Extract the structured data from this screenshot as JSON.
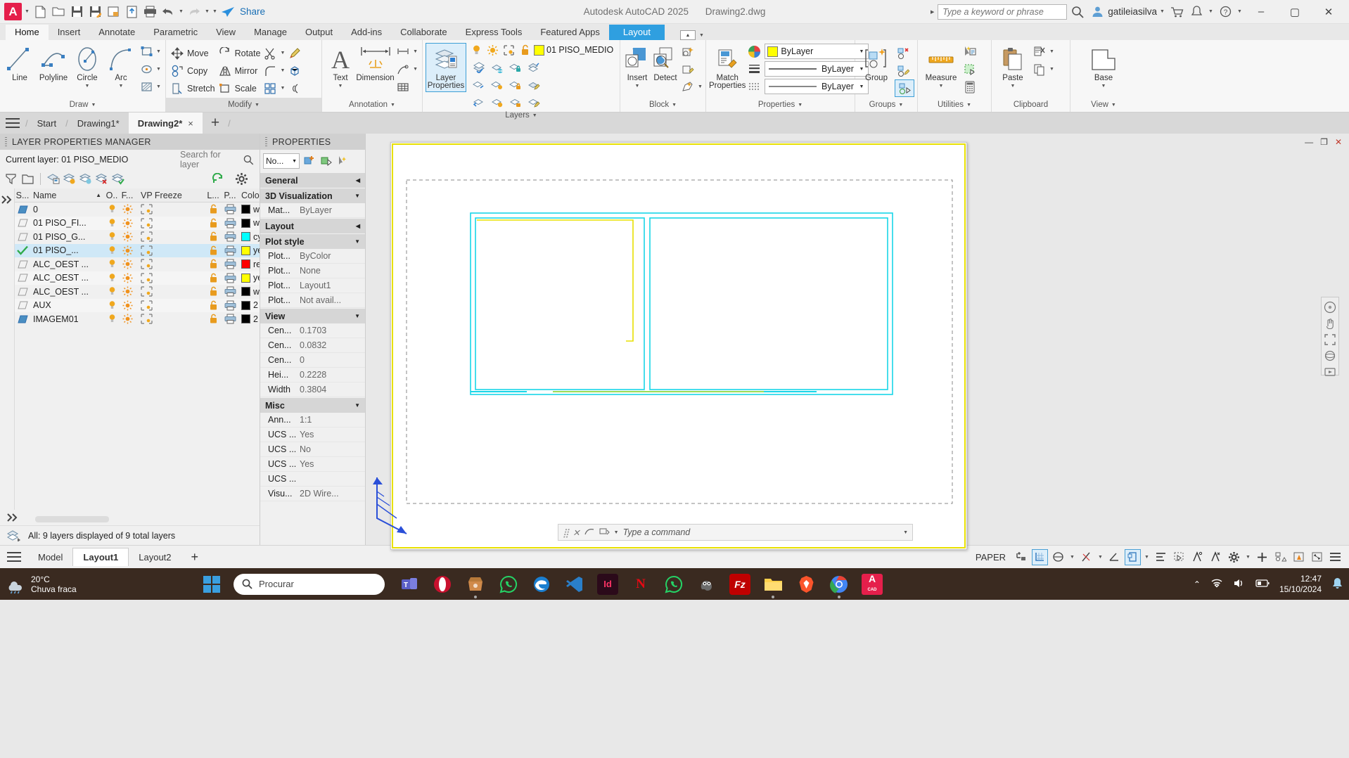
{
  "titlebar": {
    "app_title": "Autodesk AutoCAD 2025",
    "file_title": "Drawing2.dwg",
    "search_placeholder": "Type a keyword or phrase",
    "user": "gatileiasilva",
    "share_label": "Share",
    "qat": [
      {
        "name": "new-icon"
      },
      {
        "name": "open-icon"
      },
      {
        "name": "save-icon"
      },
      {
        "name": "save-as-icon"
      },
      {
        "name": "save-copy-icon"
      },
      {
        "name": "export-icon"
      },
      {
        "name": "plot-icon"
      },
      {
        "name": "undo-icon"
      },
      {
        "name": "redo-icon"
      }
    ],
    "window_buttons": [
      "minimize",
      "maximize",
      "close"
    ]
  },
  "ribbon": {
    "tabs": [
      {
        "label": "Home",
        "state": "active"
      },
      {
        "label": "Insert",
        "state": ""
      },
      {
        "label": "Annotate",
        "state": ""
      },
      {
        "label": "Parametric",
        "state": ""
      },
      {
        "label": "View",
        "state": ""
      },
      {
        "label": "Manage",
        "state": ""
      },
      {
        "label": "Output",
        "state": ""
      },
      {
        "label": "Add-ins",
        "state": ""
      },
      {
        "label": "Collaborate",
        "state": ""
      },
      {
        "label": "Express Tools",
        "state": ""
      },
      {
        "label": "Featured Apps",
        "state": ""
      },
      {
        "label": "Layout",
        "state": "highlight"
      }
    ],
    "panels": {
      "draw": {
        "title": "Draw",
        "big": [
          {
            "label": "Line",
            "icon": "line-icon"
          },
          {
            "label": "Polyline",
            "icon": "polyline-icon"
          },
          {
            "label": "Circle",
            "icon": "circle-icon"
          },
          {
            "label": "Arc",
            "icon": "arc-icon"
          }
        ],
        "small": [
          "rectangle-icon",
          "ellipse-icon",
          "hatch-icon"
        ]
      },
      "modify": {
        "title": "Modify",
        "items": [
          {
            "label": "Move",
            "icon": "move-icon"
          },
          {
            "label": "Rotate",
            "icon": "rotate-icon"
          },
          {
            "label": "Copy",
            "icon": "copy-icon"
          },
          {
            "label": "Mirror",
            "icon": "mirror-icon"
          },
          {
            "label": "Stretch",
            "icon": "stretch-icon"
          },
          {
            "label": "Scale",
            "icon": "scale-icon"
          }
        ],
        "extra": [
          "trim-icon",
          "fillet-icon",
          "array-icon",
          "explode-icon",
          "offset-icon",
          "erase-icon"
        ]
      },
      "annotation": {
        "title": "Annotation",
        "text_label": "Text",
        "dimension_label": "Dimension",
        "extra": [
          "leader-icon",
          "table-icon"
        ]
      },
      "layers": {
        "title": "Layers",
        "layer_properties_label": "Layer Properties",
        "current_layer": "01 PISO_MEDIO",
        "current_layer_color": "#ffff00"
      },
      "block": {
        "title": "Block",
        "insert_label": "Insert",
        "detect_label": "Detect"
      },
      "properties": {
        "title": "Properties",
        "match_properties_label": "Match Properties",
        "color_value": "ByLayer",
        "color_swatch": "#ffff00",
        "linetype_value": "ByLayer",
        "lineweight_value": "ByLayer"
      },
      "groups": {
        "title": "Groups",
        "group_label": "Group"
      },
      "utilities": {
        "title": "Utilities",
        "measure_label": "Measure"
      },
      "clipboard": {
        "title": "Clipboard",
        "paste_label": "Paste"
      },
      "view": {
        "title": "View",
        "base_label": "Base"
      }
    }
  },
  "file_tabs": [
    {
      "label": "Start",
      "state": ""
    },
    {
      "label": "Drawing1*",
      "state": ""
    },
    {
      "label": "Drawing2*",
      "state": "active",
      "close": "×"
    }
  ],
  "file_tabs_add": "+",
  "layer_manager": {
    "title": "LAYER PROPERTIES MANAGER",
    "current_layer_label": "Current layer: 01 PISO_MEDIO",
    "search_placeholder": "Search for layer",
    "columns": [
      "S...",
      "Name",
      "O..",
      "F...",
      "VP Freeze",
      "L...",
      "P...",
      "Colo"
    ],
    "rows": [
      {
        "status": "current-other",
        "name": "0",
        "on": "on",
        "freeze": "thaw",
        "vpfreeze": "thaw",
        "lock": "unlocked",
        "plot": "plot",
        "color": "#000000",
        "color_name": "w"
      },
      {
        "status": "layer",
        "name": "01  PISO_FI...",
        "on": "on",
        "freeze": "thaw",
        "vpfreeze": "thaw",
        "lock": "unlocked",
        "plot": "plot",
        "color": "#000000",
        "color_name": "w"
      },
      {
        "status": "layer",
        "name": "01  PISO_G...",
        "on": "on",
        "freeze": "thaw",
        "vpfreeze": "thaw",
        "lock": "unlocked",
        "plot": "plot",
        "color": "#00ffff",
        "color_name": "cy"
      },
      {
        "status": "check",
        "name": "01  PISO_...",
        "on": "on",
        "freeze": "thaw",
        "vpfreeze": "thaw",
        "lock": "unlocked",
        "plot": "plot",
        "color": "#ffff00",
        "color_name": "ye"
      },
      {
        "status": "layer",
        "name": "ALC_OEST ...",
        "on": "on",
        "freeze": "thaw",
        "vpfreeze": "thaw",
        "lock": "unlocked",
        "plot": "plot",
        "color": "#ff0000",
        "color_name": "re"
      },
      {
        "status": "layer",
        "name": "ALC_OEST ...",
        "on": "on",
        "freeze": "thaw",
        "vpfreeze": "thaw",
        "lock": "unlocked",
        "plot": "plot",
        "color": "#ffff00",
        "color_name": "ye"
      },
      {
        "status": "layer",
        "name": "ALC_OEST ...",
        "on": "on",
        "freeze": "thaw",
        "vpfreeze": "thaw",
        "lock": "unlocked",
        "plot": "plot",
        "color": "#000000",
        "color_name": "w"
      },
      {
        "status": "layer",
        "name": "AUX",
        "on": "on",
        "freeze": "thaw",
        "vpfreeze": "thaw",
        "lock": "unlocked",
        "plot": "plot",
        "color": "#000000",
        "color_name": "2"
      },
      {
        "status": "current-other",
        "name": "IMAGEM01",
        "on": "on",
        "freeze": "thaw",
        "vpfreeze": "thaw",
        "lock": "unlocked",
        "plot": "plot",
        "color": "#000000",
        "color_name": "2"
      }
    ],
    "status_text": "All: 9 layers displayed of 9 total layers"
  },
  "properties_palette": {
    "title": "PROPERTIES",
    "selector_value": "No...",
    "sections": [
      {
        "name": "General",
        "collapsed": true,
        "rows": []
      },
      {
        "name": "3D Visualization",
        "collapsed": false,
        "rows": [
          {
            "k": "Mat...",
            "v": "ByLayer"
          }
        ]
      },
      {
        "name": "Layout",
        "collapsed": true,
        "rows": []
      },
      {
        "name": "Plot style",
        "collapsed": false,
        "rows": [
          {
            "k": "Plot...",
            "v": "ByColor"
          },
          {
            "k": "Plot...",
            "v": "None"
          },
          {
            "k": "Plot...",
            "v": "Layout1"
          },
          {
            "k": "Plot...",
            "v": "Not avail..."
          }
        ]
      },
      {
        "name": "View",
        "collapsed": false,
        "rows": [
          {
            "k": "Cen...",
            "v": "0.1703"
          },
          {
            "k": "Cen...",
            "v": "0.0832"
          },
          {
            "k": "Cen...",
            "v": "0"
          },
          {
            "k": "Hei...",
            "v": "0.2228"
          },
          {
            "k": "Width",
            "v": "0.3804"
          }
        ]
      },
      {
        "name": "Misc",
        "collapsed": false,
        "rows": [
          {
            "k": "Ann...",
            "v": "1:1"
          },
          {
            "k": "UCS ...",
            "v": "Yes"
          },
          {
            "k": "UCS ...",
            "v": "No"
          },
          {
            "k": "UCS ...",
            "v": "Yes"
          },
          {
            "k": "UCS ...",
            "v": ""
          },
          {
            "k": "Visu...",
            "v": "2D Wire..."
          }
        ]
      }
    ]
  },
  "canvas": {
    "command_placeholder": "Type a command",
    "ucs_label": "",
    "window_controls": [
      "minimize",
      "restore",
      "close"
    ]
  },
  "statusbar": {
    "model_tab": "Model",
    "layout_tabs": [
      {
        "label": "Layout1",
        "state": "active"
      },
      {
        "label": "Layout2",
        "state": ""
      }
    ],
    "add_layout": "+",
    "space_mode": "PAPER",
    "toggles": [
      {
        "name": "snap-mode-icon",
        "on": false
      },
      {
        "name": "grid-display-icon",
        "on": true
      },
      {
        "name": "ortho-mode-icon",
        "on": false
      },
      {
        "name": "polar-tracking-icon",
        "on": false
      },
      {
        "name": "object-snap-icon",
        "on": false
      },
      {
        "name": "isometric-drafting-icon",
        "on": false
      },
      {
        "name": "viewport-lock-icon",
        "on": true
      },
      {
        "name": "annotation-visibility-icon",
        "on": false
      },
      {
        "name": "selection-cycling-icon",
        "on": false
      },
      {
        "name": "annotation-scale-icon",
        "on": false
      },
      {
        "name": "autoscale-icon",
        "on": false
      },
      {
        "name": "workspace-switching-icon",
        "on": false
      },
      {
        "name": "add-tools-icon",
        "on": false
      },
      {
        "name": "isolate-objects-icon",
        "on": false
      },
      {
        "name": "hardware-acceleration-icon",
        "on": false
      },
      {
        "name": "fullscreen-icon",
        "on": false
      },
      {
        "name": "customization-icon",
        "on": false
      }
    ]
  },
  "taskbar": {
    "temperature": "20°C",
    "weather": "Chuva fraca",
    "search_placeholder": "Procurar",
    "apps": [
      {
        "name": "start-icon",
        "glyph": "",
        "color": "#2b88d8"
      },
      {
        "name": "teams-icon",
        "glyph": "",
        "color": "#5b5fc7"
      },
      {
        "name": "opera-icon",
        "glyph": "O",
        "color": "#d8122e"
      },
      {
        "name": "store-icon",
        "glyph": "",
        "color": "#c77b3a"
      },
      {
        "name": "whatsapp-icon",
        "glyph": "",
        "color": "#25d366"
      },
      {
        "name": "edge-icon",
        "glyph": "",
        "color": "#1b7fd0"
      },
      {
        "name": "vscode-icon",
        "glyph": "",
        "color": "#2a7fc9"
      },
      {
        "name": "indesign-icon",
        "glyph": "Id",
        "color": "#ff3366"
      },
      {
        "name": "netflix-icon",
        "glyph": "N",
        "color": "#e50914"
      },
      {
        "name": "whatsapp2-icon",
        "glyph": "",
        "color": "#25d366"
      },
      {
        "name": "gimp-icon",
        "glyph": "",
        "color": "#5c5c5c"
      },
      {
        "name": "filezilla-icon",
        "glyph": "Fz",
        "color": "#bf0000"
      },
      {
        "name": "explorer-icon",
        "glyph": "",
        "color": "#ffd04b"
      },
      {
        "name": "brave-icon",
        "glyph": "",
        "color": "#fb542b"
      },
      {
        "name": "chrome-icon",
        "glyph": "",
        "color": "#34a853"
      },
      {
        "name": "autocad-icon",
        "glyph": "A",
        "color": "#e51f4b"
      }
    ],
    "time": "12:47",
    "date": "15/10/2024"
  }
}
